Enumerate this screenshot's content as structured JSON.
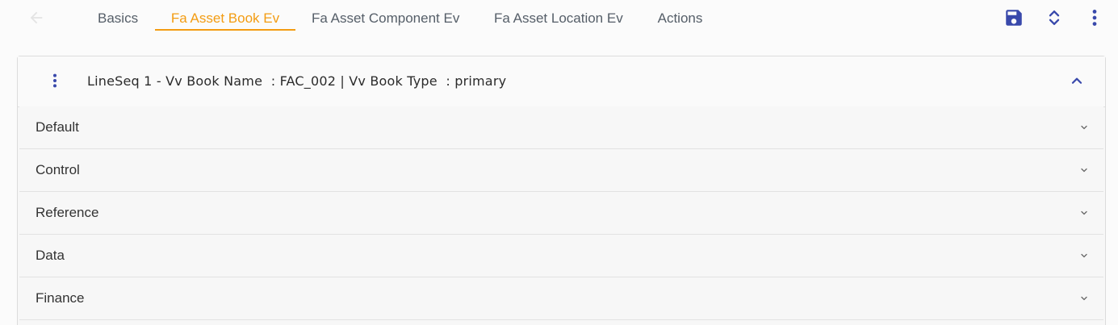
{
  "tabs": [
    {
      "label": "Basics"
    },
    {
      "label": "Fa Asset Book Ev"
    },
    {
      "label": "Fa Asset Component Ev"
    },
    {
      "label": "Fa Asset Location Ev"
    },
    {
      "label": "Actions"
    }
  ],
  "active_tab": "Fa Asset Book Ev",
  "toolbar": {
    "icons": [
      "save-icon",
      "expand-collapse-icon",
      "more-vert-icon"
    ]
  },
  "card": {
    "title": "LineSeq 1 - Vv Book Name  : FAC_002 | Vv Book Type  : primary",
    "sections": [
      {
        "label": "Default"
      },
      {
        "label": "Control"
      },
      {
        "label": "Reference"
      },
      {
        "label": "Data"
      },
      {
        "label": "Finance"
      }
    ]
  },
  "colors": {
    "accent": "#f39c12",
    "icon_primary": "#3949ab",
    "tab_text": "#555e68"
  }
}
